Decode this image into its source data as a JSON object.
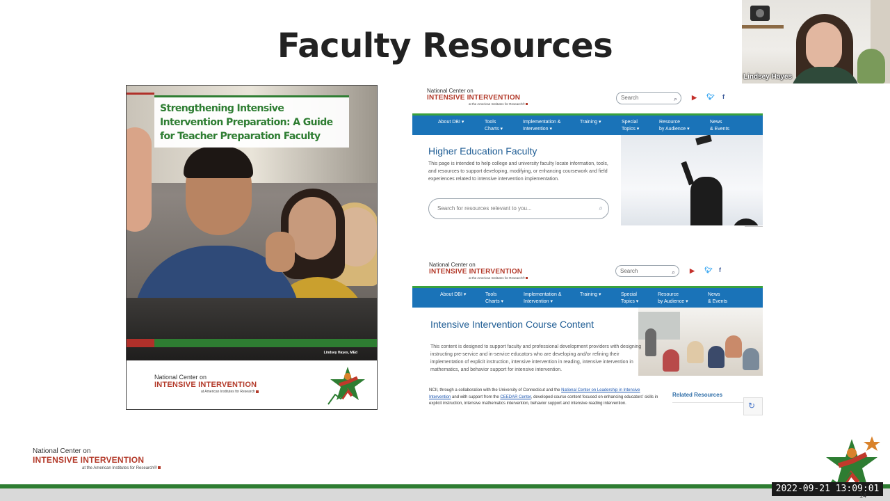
{
  "slide": {
    "title": "Faculty Resources",
    "page_number": "14"
  },
  "guide_cover": {
    "title": "Strengthening Intensive Intervention Preparation: A Guide for Teacher Preparation Faculty",
    "author": "Lindsey Hayes, MEd",
    "logo": {
      "line1": "National Center on",
      "line2": "INTENSIVE INTERVENTION",
      "line3": "at American Institutes for Research"
    }
  },
  "web_page_1": {
    "logo": {
      "line1": "National Center on",
      "line2": "INTENSIVE INTERVENTION",
      "line3": "at the American Institutes for Research®"
    },
    "search_placeholder": "Search",
    "social_icons": [
      "youtube-icon",
      "twitter-icon",
      "facebook-icon"
    ],
    "nav": [
      {
        "line1": "About DBI ▾",
        "line2": ""
      },
      {
        "line1": "Tools",
        "line2": "Charts ▾"
      },
      {
        "line1": "Implementation &",
        "line2": "Intervention ▾"
      },
      {
        "line1": "Training ▾",
        "line2": ""
      },
      {
        "line1": "Special",
        "line2": "Topics ▾"
      },
      {
        "line1": "Resource",
        "line2": "by Audience ▾"
      },
      {
        "line1": "News",
        "line2": "& Events"
      }
    ],
    "heading": "Higher Education Faculty",
    "body": "This page is intended to help college and university faculty locate information, tools, and resources to support developing, modifying, or enhancing coursework and field experiences related to intensive intervention implementation.",
    "resource_search_placeholder": "Search for resources relevant to you..."
  },
  "web_page_2": {
    "logo": {
      "line1": "National Center on",
      "line2": "INTENSIVE INTERVENTION",
      "line3": "at the American Institutes for Research®"
    },
    "search_placeholder": "Search",
    "social_icons": [
      "youtube-icon",
      "twitter-icon",
      "facebook-icon"
    ],
    "nav": [
      {
        "line1": "About DBI ▾",
        "line2": ""
      },
      {
        "line1": "Tools",
        "line2": "Charts ▾"
      },
      {
        "line1": "Implementation &",
        "line2": "Intervention ▾"
      },
      {
        "line1": "Training ▾",
        "line2": ""
      },
      {
        "line1": "Special",
        "line2": "Topics ▾"
      },
      {
        "line1": "Resource",
        "line2": "by Audience ▾"
      },
      {
        "line1": "News",
        "line2": "& Events"
      }
    ],
    "heading": "Intensive Intervention Course Content",
    "body": "This content is designed to support faculty and professional development providers with designing instructing pre-service and in-service educators who are developing and/or refining their implementation of explicit instruction, intensive intervention in reading, intensive intervention in mathematics, and behavior support for intensive intervention.",
    "para_part1": "NCII, through a collaboration with the University of Connecticut and the ",
    "para_link1": "National Center on Leadership in Intensive Intervention",
    "para_part2": " and with support from the ",
    "para_link2": "CEEDAR Center",
    "para_part3": ", developed course content focused on enhancing educators' skills in explicit instruction, intensive mathematics intervention, behavior support and intensive reading intervention.",
    "related_resources": "Related Resources"
  },
  "webcam": {
    "participant_name": "Lindsey Hayes"
  },
  "footer": {
    "logo": {
      "line1": "National Center on",
      "line2": "INTENSIVE INTERVENTION",
      "line3": "at the American Institutes for Research®"
    },
    "timestamp": "2022-09-21 13:09:01"
  },
  "colors": {
    "brand_red": "#b33a2a",
    "brand_green": "#2e7d32",
    "nav_blue": "#1a73b8",
    "heading_blue": "#1f5d94"
  }
}
